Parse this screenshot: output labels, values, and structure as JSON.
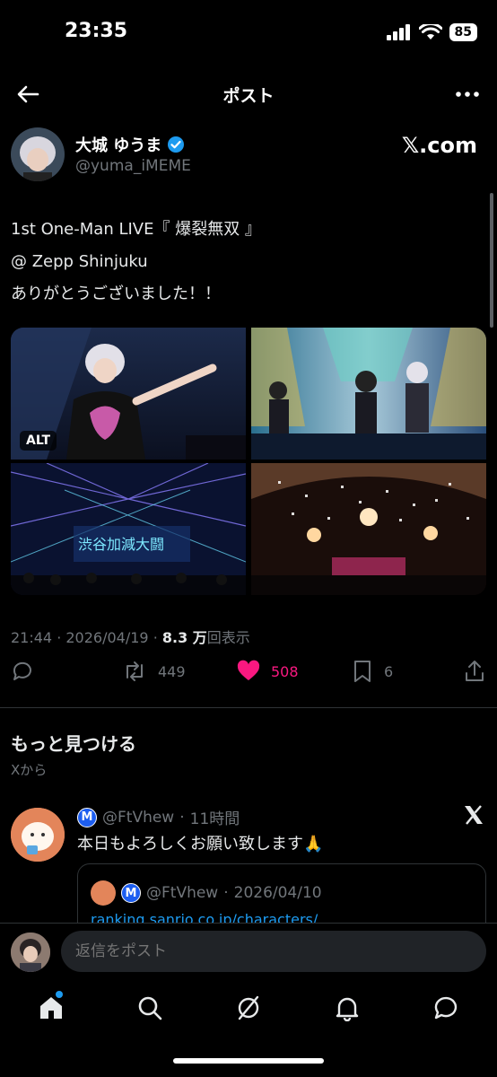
{
  "status_bar": {
    "time": "23:35",
    "battery": "85"
  },
  "header": {
    "title": "ポスト"
  },
  "author": {
    "name": "大城 ゆうま",
    "handle": "@yuma_iMEME",
    "source_badge": "𝕏.com"
  },
  "tweet": {
    "lines": [
      "1st One-Man LIVE『 爆裂無双 』",
      "@ Zepp Shinjuku",
      "ありがとうございました！！"
    ]
  },
  "media": {
    "alt_badge": "ALT",
    "count": 4
  },
  "meta": {
    "time": "21:44",
    "date": "2026/04/19",
    "views": "8.3 万",
    "views_suffix": "回表示"
  },
  "actions": {
    "retweets": "449",
    "likes": "508",
    "bookmarks": "6",
    "liked": true
  },
  "discover": {
    "title": "もっと見つける",
    "subtitle": "Xから"
  },
  "recommended": {
    "handle": "@FtVhew",
    "time": "11時間",
    "text": "本日もよろしくお願い致します🙏",
    "badge": "M",
    "quote": {
      "handle": "@FtVhew",
      "date": "2026/04/10",
      "link": "ranking.sanrio.co.jp/characters/"
    }
  },
  "reply": {
    "placeholder": "返信をポスト"
  },
  "nav": {
    "items": [
      "home-icon",
      "search-icon",
      "grok-icon",
      "notifications-icon",
      "messages-icon"
    ]
  },
  "colors": {
    "accent": "#1d9bf0",
    "like": "#f91880",
    "muted": "#71767b",
    "bg": "#000000"
  }
}
